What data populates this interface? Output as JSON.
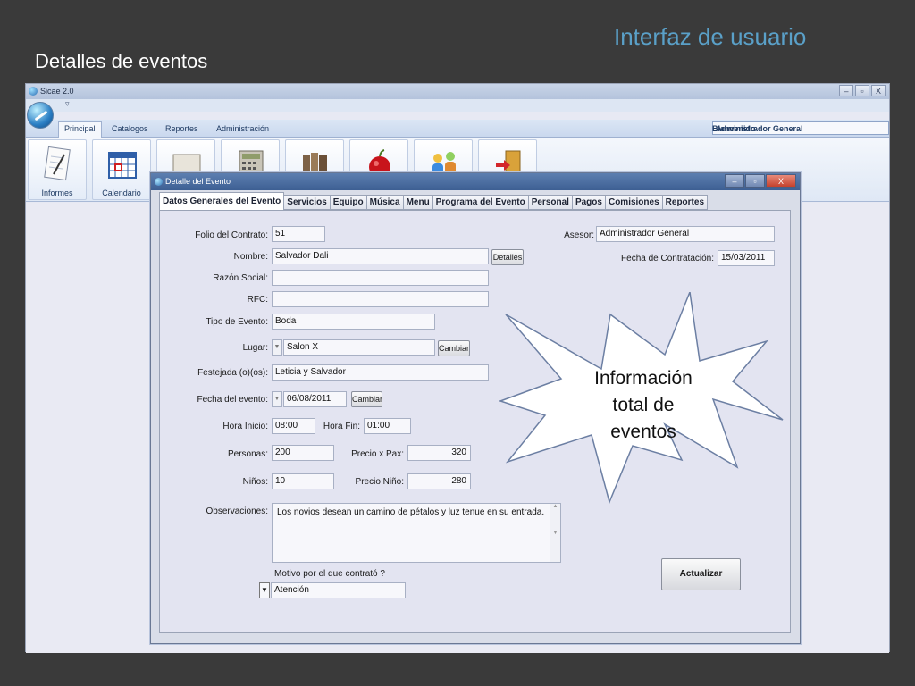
{
  "slide": {
    "title": "Interfaz de usuario",
    "subtitle": "Detalles de eventos"
  },
  "app": {
    "title": "Sicae 2.0",
    "quick_access": "▿",
    "ribbon_tabs": [
      "Principal",
      "Catalogos",
      "Reportes",
      "Administración"
    ],
    "active_tab": "Principal",
    "welcome_label": "Bienvenido",
    "welcome_user": "Administrador General",
    "ribbon_buttons": [
      {
        "label": "Informes",
        "icon": "notepad-icon"
      },
      {
        "label": "Calendario",
        "icon": "calendar-icon"
      },
      {
        "label": "",
        "icon": "folder-icon"
      },
      {
        "label": "",
        "icon": "calculator-icon"
      },
      {
        "label": "",
        "icon": "books-icon"
      },
      {
        "label": "",
        "icon": "apple-icon"
      },
      {
        "label": "",
        "icon": "users-icon"
      },
      {
        "label": "",
        "icon": "exit-door-icon"
      }
    ],
    "win_controls": [
      "–",
      "▫",
      "X"
    ]
  },
  "dialog": {
    "title": "Detalle del Evento",
    "tabs": [
      "Datos Generales del Evento",
      "Servicios",
      "Equipo",
      "Música",
      "Menu",
      "Programa del Evento",
      "Personal",
      "Pagos",
      "Comisiones",
      "Reportes"
    ],
    "active_tab": "Datos Generales del Evento",
    "fields": {
      "folio_label": "Folio del Contrato:",
      "folio_value": "51",
      "asesor_label": "Asesor:",
      "asesor_value": "Administrador General",
      "nombre_label": "Nombre:",
      "nombre_value": "Salvador Dali",
      "detalles_button": "Detalles",
      "fecha_contratacion_label": "Fecha de Contratación:",
      "fecha_contratacion_value": "15/03/2011",
      "razon_social_label": "Razón Social:",
      "razon_social_value": "",
      "rfc_label": "RFC:",
      "rfc_value": "",
      "tipo_evento_label": "Tipo de Evento:",
      "tipo_evento_value": "Boda",
      "lugar_label": "Lugar:",
      "lugar_value": "Salon X",
      "cambiar_lugar_button": "Cambiar",
      "festejada_label": "Festejada (o)(os):",
      "festejada_value": "Leticia y Salvador",
      "fecha_evento_label": "Fecha del evento:",
      "fecha_evento_value": "06/08/2011",
      "cambiar_fecha_button": "Cambiar",
      "hora_inicio_label": "Hora Inicio:",
      "hora_inicio_value": "08:00",
      "hora_fin_label": "Hora Fin:",
      "hora_fin_value": "01:00",
      "personas_label": "Personas:",
      "personas_value": "200",
      "precio_pax_label": "Precio x Pax:",
      "precio_pax_value": "320",
      "ninos_label": "Niños:",
      "ninos_value": "10",
      "precio_nino_label": "Precio Niño:",
      "precio_nino_value": "280",
      "observaciones_label": "Observaciones:",
      "observaciones_value": "Los novios desean un camino de pétalos y luz tenue en su entrada.",
      "motivo_label": "Motivo por el que contrató ?",
      "motivo_value": "Atención",
      "actualizar_button": "Actualizar"
    }
  },
  "callout": {
    "line1": "Información",
    "line2": "total de",
    "line3": "eventos"
  }
}
